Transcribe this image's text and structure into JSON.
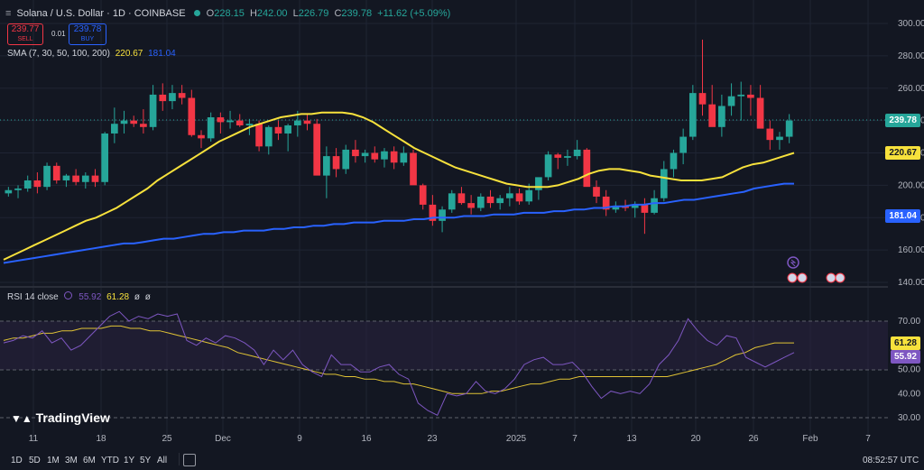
{
  "header": {
    "symbol_title": "Solana / U.S. Dollar · 1D · COINBASE",
    "ohlc": {
      "o_label": "O",
      "o": "228.15",
      "h_label": "H",
      "h": "242.00",
      "l_label": "L",
      "l": "226.79",
      "c_label": "C",
      "c": "239.78",
      "chg": "+11.62 (+5.09%)"
    },
    "sell": {
      "price": "239.77",
      "label": "SELL"
    },
    "spread": "0.01",
    "buy": {
      "price": "239.78",
      "label": "BUY"
    },
    "sma_label": "SMA (7, 30, 50, 100, 200)",
    "sma_v1": "220.67",
    "sma_v2": "181.04"
  },
  "rsi": {
    "label": "RSI 14 close",
    "v1": "55.92",
    "v2": "61.28",
    "v3": "ø",
    "v4": "ø"
  },
  "price_axis": [
    "300.00",
    "280.00",
    "260.00",
    "240.00",
    "220.00",
    "200.00",
    "180.00",
    "160.00",
    "140.00"
  ],
  "rsi_axis": [
    "70.00",
    "60.00",
    "50.00",
    "40.00",
    "30.00"
  ],
  "tags": {
    "last_price": "239.78",
    "sma_yellow": "220.67",
    "sma_blue": "181.04",
    "rsi_ma": "61.28",
    "rsi": "55.92"
  },
  "date_labels": [
    "11",
    "18",
    "25",
    "Dec",
    "9",
    "16",
    "23",
    "2025",
    "7",
    "13",
    "20",
    "26",
    "Feb",
    "7"
  ],
  "timeframes": [
    "1D",
    "5D",
    "1M",
    "3M",
    "6M",
    "YTD",
    "1Y",
    "5Y",
    "All"
  ],
  "footer": {
    "clock": "08:52:57 UTC",
    "logo_text": "TradingView"
  },
  "colors": {
    "up": "#26a69a",
    "down": "#f23645",
    "sma_yellow": "#f7e13c",
    "sma_blue": "#2962ff",
    "rsi_line": "#7e57c2"
  },
  "chart_data": {
    "type": "candlestick",
    "candles": [
      [
        195,
        199,
        193,
        197
      ],
      [
        197,
        200,
        192,
        198
      ],
      [
        198,
        206,
        196,
        203
      ],
      [
        203,
        208,
        195,
        199
      ],
      [
        199,
        214,
        197,
        212
      ],
      [
        212,
        214,
        201,
        203
      ],
      [
        203,
        207,
        199,
        206
      ],
      [
        206,
        210,
        200,
        202
      ],
      [
        202,
        208,
        198,
        206
      ],
      [
        206,
        210,
        199,
        202
      ],
      [
        202,
        233,
        200,
        232
      ],
      [
        232,
        248,
        226,
        238
      ],
      [
        238,
        246,
        232,
        240
      ],
      [
        240,
        243,
        236,
        238
      ],
      [
        238,
        247,
        232,
        236
      ],
      [
        236,
        262,
        234,
        256
      ],
      [
        256,
        263,
        246,
        252
      ],
      [
        252,
        262,
        247,
        257
      ],
      [
        257,
        262,
        250,
        254
      ],
      [
        254,
        259,
        230,
        231
      ],
      [
        231,
        234,
        223,
        229
      ],
      [
        229,
        245,
        227,
        242
      ],
      [
        242,
        245,
        232,
        239
      ],
      [
        239,
        246,
        235,
        240
      ],
      [
        240,
        244,
        236,
        237
      ],
      [
        237,
        241,
        231,
        238
      ],
      [
        238,
        240,
        221,
        224
      ],
      [
        224,
        237,
        219,
        236
      ],
      [
        236,
        240,
        228,
        232
      ],
      [
        232,
        238,
        221,
        237
      ],
      [
        237,
        246,
        230,
        240
      ],
      [
        240,
        244,
        234,
        238
      ],
      [
        238,
        241,
        225,
        206
      ],
      [
        206,
        224,
        192,
        218
      ],
      [
        218,
        223,
        205,
        210
      ],
      [
        210,
        225,
        207,
        222
      ],
      [
        222,
        228,
        214,
        218
      ],
      [
        218,
        222,
        214,
        220
      ],
      [
        220,
        224,
        214,
        216
      ],
      [
        216,
        223,
        211,
        221
      ],
      [
        221,
        224,
        210,
        214
      ],
      [
        214,
        224,
        212,
        220
      ],
      [
        220,
        222,
        208,
        200
      ],
      [
        200,
        201,
        185,
        188
      ],
      [
        188,
        194,
        175,
        178
      ],
      [
        178,
        187,
        171,
        185
      ],
      [
        185,
        197,
        183,
        195
      ],
      [
        195,
        199,
        188,
        189
      ],
      [
        189,
        194,
        182,
        186
      ],
      [
        186,
        195,
        184,
        193
      ],
      [
        193,
        197,
        186,
        189
      ],
      [
        189,
        194,
        185,
        192
      ],
      [
        192,
        199,
        187,
        195
      ],
      [
        195,
        198,
        188,
        190
      ],
      [
        190,
        201,
        188,
        197
      ],
      [
        197,
        204,
        191,
        205
      ],
      [
        205,
        221,
        203,
        219
      ],
      [
        219,
        220,
        210,
        217
      ],
      [
        217,
        222,
        212,
        218
      ],
      [
        218,
        228,
        216,
        222
      ],
      [
        222,
        223,
        207,
        199
      ],
      [
        199,
        203,
        189,
        193
      ],
      [
        193,
        197,
        181,
        185
      ],
      [
        185,
        190,
        183,
        187
      ],
      [
        187,
        191,
        184,
        186
      ],
      [
        186,
        190,
        180,
        188
      ],
      [
        188,
        192,
        170,
        183
      ],
      [
        183,
        197,
        182,
        192
      ],
      [
        192,
        215,
        190,
        210
      ],
      [
        210,
        222,
        205,
        220
      ],
      [
        220,
        235,
        213,
        230
      ],
      [
        230,
        262,
        228,
        257
      ],
      [
        257,
        290,
        243,
        250
      ],
      [
        250,
        262,
        238,
        236
      ],
      [
        236,
        256,
        230,
        249
      ],
      [
        249,
        263,
        243,
        255
      ],
      [
        255,
        264,
        240,
        256
      ],
      [
        256,
        262,
        243,
        254
      ],
      [
        254,
        262,
        238,
        235
      ],
      [
        235,
        240,
        222,
        228
      ],
      [
        228,
        233,
        222,
        230
      ],
      [
        230,
        244,
        226,
        240
      ]
    ],
    "sma50": [
      154,
      157,
      160,
      163,
      166,
      169,
      172,
      175,
      178,
      180,
      183,
      186,
      190,
      194,
      198,
      203,
      207,
      211,
      215,
      219,
      223,
      227,
      230,
      233,
      236,
      238,
      240,
      242,
      243,
      244,
      244,
      245,
      245,
      245,
      244,
      242,
      239,
      235,
      231,
      227,
      223,
      220,
      217,
      214,
      211,
      209,
      207,
      205,
      203,
      201,
      200,
      199,
      199,
      199,
      200,
      202,
      204,
      207,
      209,
      210,
      210,
      209,
      208,
      206,
      205,
      204,
      203,
      203,
      203,
      204,
      205,
      208,
      211,
      213,
      214,
      216,
      218,
      220
    ],
    "sma200": [
      152,
      153,
      154,
      155,
      156,
      157,
      158,
      159,
      160,
      161,
      162,
      163,
      164,
      164,
      165,
      166,
      167,
      167,
      168,
      169,
      170,
      170,
      171,
      171,
      172,
      172,
      172,
      173,
      173,
      174,
      174,
      175,
      175,
      176,
      176,
      177,
      177,
      177,
      178,
      178,
      178,
      179,
      179,
      180,
      180,
      180,
      181,
      181,
      181,
      182,
      182,
      182,
      183,
      183,
      183,
      184,
      184,
      185,
      185,
      186,
      186,
      187,
      187,
      188,
      188,
      189,
      189,
      190,
      191,
      191,
      192,
      193,
      194,
      195,
      196,
      198,
      199,
      200,
      201,
      201
    ],
    "rsi": [
      61,
      62,
      64,
      63,
      66,
      61,
      63,
      58,
      60,
      64,
      68,
      72,
      74,
      70,
      72,
      71,
      73,
      72,
      73,
      62,
      60,
      63,
      61,
      64,
      63,
      61,
      58,
      52,
      58,
      54,
      58,
      52,
      49,
      47,
      56,
      52,
      52,
      49,
      49,
      51,
      52,
      48,
      46,
      36,
      33,
      31,
      40,
      39,
      40,
      45,
      41,
      40,
      42,
      46,
      52,
      54,
      55,
      52,
      52,
      53,
      49,
      43,
      38,
      41,
      40,
      41,
      40,
      44,
      52,
      56,
      62,
      71,
      66,
      62,
      60,
      64,
      63,
      55,
      53,
      51,
      53,
      55,
      57
    ],
    "rsi_ma": [
      62,
      63,
      63,
      64,
      65,
      65,
      66,
      66,
      67,
      67,
      67,
      68,
      68,
      67,
      67,
      66,
      66,
      65,
      64,
      63,
      62,
      61,
      60,
      59,
      57,
      56,
      55,
      54,
      53,
      52,
      51,
      50,
      49,
      48,
      48,
      47,
      47,
      46,
      46,
      45,
      45,
      44,
      44,
      43,
      42,
      41,
      40,
      40,
      40,
      40,
      41,
      41,
      42,
      43,
      44,
      44,
      45,
      46,
      46,
      47,
      47,
      47,
      47,
      47,
      47,
      47,
      47,
      47,
      47,
      48,
      49,
      50,
      51,
      52,
      54,
      56,
      57,
      59,
      60,
      61,
      61,
      61
    ],
    "price_ylim": [
      135,
      305
    ],
    "rsi_ylim": [
      25,
      80
    ]
  }
}
